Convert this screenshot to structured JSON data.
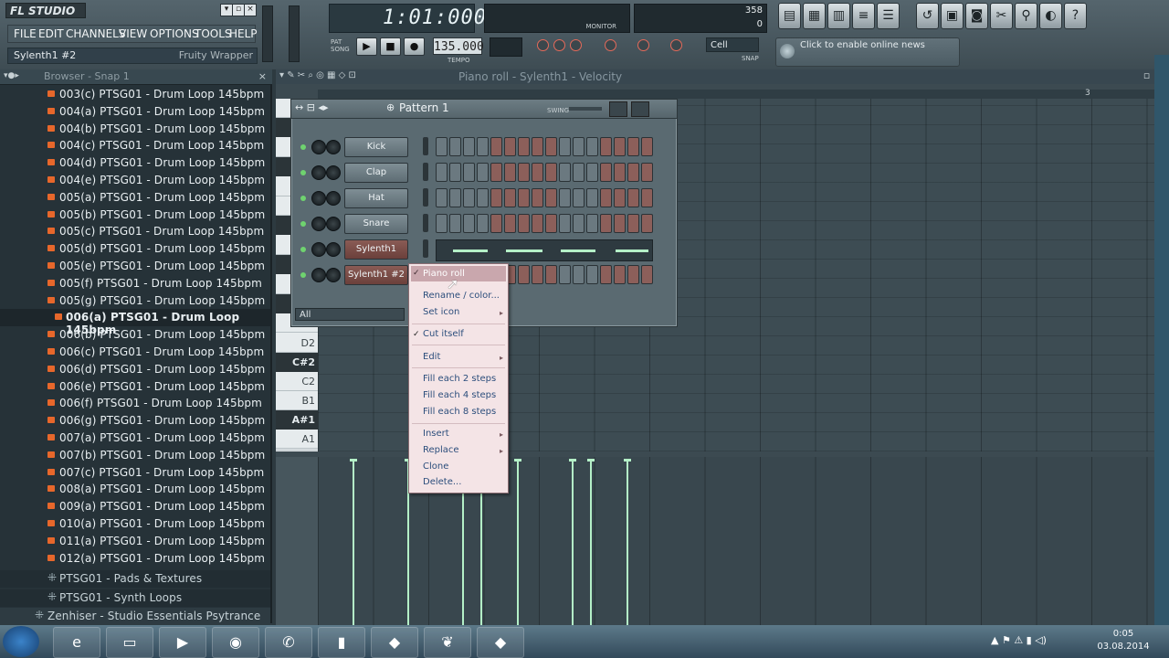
{
  "app": {
    "logo": "FL STUDIO"
  },
  "menu": [
    "FILE",
    "EDIT",
    "CHANNELS",
    "VIEW",
    "OPTIONS",
    "TOOLS",
    "HELP"
  ],
  "hint": {
    "left": "Sylenth1 #2",
    "right": "Fruity Wrapper"
  },
  "transport": {
    "song_time": "1:01:000",
    "tempo": "135.000",
    "tempo_label": "TEMPO",
    "pat_label": "PAT",
    "song_label": "SONG",
    "snap": "Cell",
    "snap_label": "SNAP",
    "cpu_value": "358",
    "poly_value": "0",
    "monitor_label": "MONITOR"
  },
  "news": {
    "text": "Click to enable online news"
  },
  "browser": {
    "title": "Browser - Snap 1",
    "items": [
      "003(c) PTSG01 - Drum Loop 145bpm",
      "004(a) PTSG01 - Drum Loop 145bpm",
      "004(b) PTSG01 - Drum Loop 145bpm",
      "004(c) PTSG01 - Drum Loop 145bpm",
      "004(d) PTSG01 - Drum Loop 145bpm",
      "004(e) PTSG01 - Drum Loop 145bpm",
      "005(a) PTSG01 - Drum Loop 145bpm",
      "005(b) PTSG01 - Drum Loop 145bpm",
      "005(c) PTSG01 - Drum Loop 145bpm",
      "005(d) PTSG01 - Drum Loop 145bpm",
      "005(e) PTSG01 - Drum Loop 145bpm",
      "005(f) PTSG01 - Drum Loop 145bpm",
      "005(g) PTSG01 - Drum Loop 145bpm",
      "006(a) PTSG01 - Drum Loop 145bpm",
      "006(b) PTSG01 - Drum Loop 145bpm",
      "006(c) PTSG01 - Drum Loop 145bpm",
      "006(d) PTSG01 - Drum Loop 145bpm",
      "006(e) PTSG01 - Drum Loop 145bpm",
      "006(f) PTSG01 - Drum Loop 145bpm",
      "006(g) PTSG01 - Drum Loop 145bpm",
      "007(a) PTSG01 - Drum Loop 145bpm",
      "007(b) PTSG01 - Drum Loop 145bpm",
      "007(c) PTSG01 - Drum Loop 145bpm",
      "008(a) PTSG01 - Drum Loop 145bpm",
      "009(a) PTSG01 - Drum Loop 145bpm",
      "010(a) PTSG01 - Drum Loop 145bpm",
      "011(a) PTSG01 - Drum Loop 145bpm",
      "012(a) PTSG01 - Drum Loop 145bpm"
    ],
    "selected_index": 13,
    "folders": [
      "PTSG01 - Pads & Textures",
      "PTSG01 - Synth Loops",
      "Zenhiser - Studio Essentials Psytrance"
    ]
  },
  "piano_roll": {
    "title": "Piano roll - Sylenth1 - Velocity",
    "bar_marker": "3",
    "keys": [
      "D2",
      "C#2",
      "C2",
      "B1",
      "A#1",
      "A1"
    ]
  },
  "channel_rack": {
    "pattern": "Pattern 1",
    "swing_label": "SWING",
    "filter": "All",
    "channels": [
      {
        "name": "Kick"
      },
      {
        "name": "Clap"
      },
      {
        "name": "Hat"
      },
      {
        "name": "Snare"
      },
      {
        "name": "Sylenth1"
      },
      {
        "name": "Sylenth1 #2"
      }
    ]
  },
  "context_menu": {
    "items": [
      "Piano roll",
      "Rename / color...",
      "Set icon",
      "Cut itself",
      "Edit",
      "Fill each 2 steps",
      "Fill each 4 steps",
      "Fill each 8 steps",
      "Insert",
      "Replace",
      "Clone",
      "Delete..."
    ]
  },
  "clock": {
    "time": "0:05",
    "date": "03.08.2014"
  },
  "colors": {
    "accent_note": "#b4f0c7",
    "menu_bg": "#f4e4e6",
    "step_red": "#8c5f5a"
  }
}
